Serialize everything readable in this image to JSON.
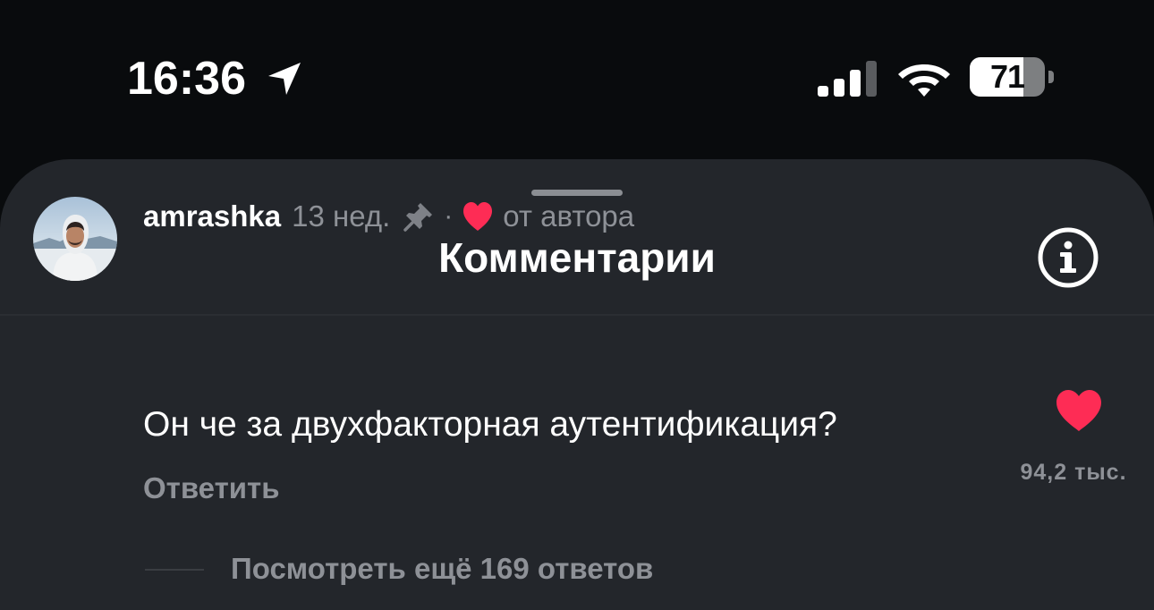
{
  "status_bar": {
    "time": "16:36",
    "battery_percent": "71",
    "battery_level": 0.71
  },
  "sheet": {
    "title": "Комментарии"
  },
  "comment": {
    "username": "amrashka",
    "age": "13 нед.",
    "separator": "·",
    "author_label": "от автора",
    "text": "Он че за двухфакторная аутентификация?",
    "reply_label": "Ответить",
    "like_count": "94,2 тыс.",
    "view_replies_label": "Посмотреть ещё 169 ответов"
  },
  "colors": {
    "sheet_background": "#23262b",
    "heart_red": "#fe2c55",
    "secondary_text": "#8e9197"
  },
  "icons": {
    "location": "location-arrow-icon",
    "signal": "cellular-signal-icon",
    "wifi": "wifi-icon",
    "info": "info-icon",
    "pin": "pin-icon",
    "heart": "heart-icon"
  }
}
